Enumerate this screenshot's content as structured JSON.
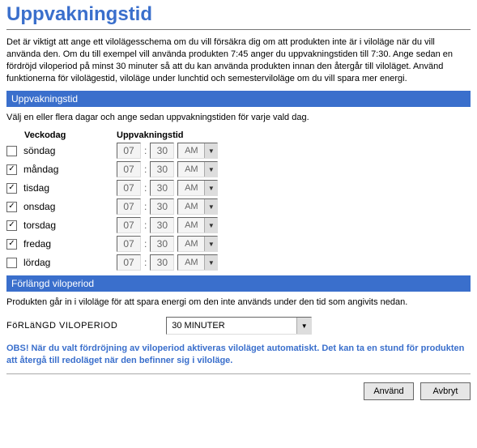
{
  "page_title": "Uppvakningstid",
  "intro": "Det är viktigt att ange ett vilolägesschema om du vill försäkra dig om att produkten inte är i viloläge när du vill använda den. Om du till exempel vill använda produkten 7:45 anger du uppvakningstiden till 7:30. Ange sedan en fördröjd viloperiod på minst 30 minuter så att du kan använda produkten innan den återgår till viloläget. Använd funktionerna för vilolägestid, viloläge under lunchtid och semesterviloläge om du vill spara mer energi.",
  "section1_title": "Uppvakningstid",
  "section1_instructions": "Välj en eller flera dagar och ange sedan uppvakningstiden för varje vald dag.",
  "headers": {
    "day": "Veckodag",
    "time": "Uppvakningstid"
  },
  "days": [
    {
      "name": "söndag",
      "checked": false,
      "hh": "07",
      "mm": "30",
      "ampm": "AM"
    },
    {
      "name": "måndag",
      "checked": true,
      "hh": "07",
      "mm": "30",
      "ampm": "AM"
    },
    {
      "name": "tisdag",
      "checked": true,
      "hh": "07",
      "mm": "30",
      "ampm": "AM"
    },
    {
      "name": "onsdag",
      "checked": true,
      "hh": "07",
      "mm": "30",
      "ampm": "AM"
    },
    {
      "name": "torsdag",
      "checked": true,
      "hh": "07",
      "mm": "30",
      "ampm": "AM"
    },
    {
      "name": "fredag",
      "checked": true,
      "hh": "07",
      "mm": "30",
      "ampm": "AM"
    },
    {
      "name": "lördag",
      "checked": false,
      "hh": "07",
      "mm": "30",
      "ampm": "AM"
    }
  ],
  "section2_title": "Förlängd viloperiod",
  "section2_intro": "Produkten går in i viloläge för att spara energi om den inte används under den tid som angivits nedan.",
  "extend_label": "FöRLäNGD VILOPERIOD",
  "extend_value": "30 MINUTER",
  "notice": "OBS! När du valt fördröjning av viloperiod aktiveras viloläget automatiskt. Det kan ta en stund för produkten att återgå till redoläget när den befinner sig i viloläge.",
  "buttons": {
    "apply": "Använd",
    "cancel": "Avbryt"
  }
}
